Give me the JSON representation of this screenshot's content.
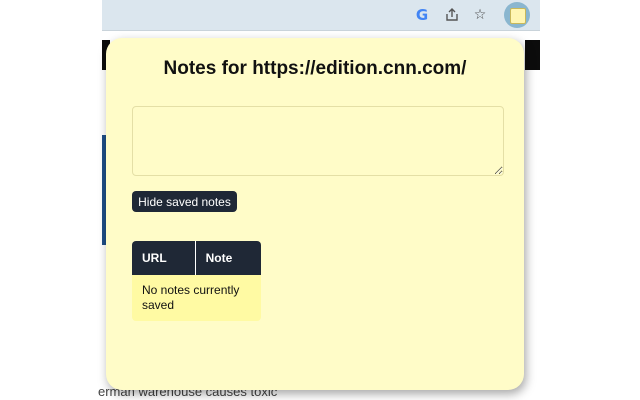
{
  "browser": {
    "icons": [
      "google-icon",
      "share-icon",
      "star-icon",
      "notes-extension-icon"
    ]
  },
  "page_background": {
    "bottom_text": "erman warehouse causes toxic"
  },
  "popup": {
    "title": "Notes for https://edition.cnn.com/",
    "note_input_value": "",
    "hide_button_label": "Hide saved notes",
    "table": {
      "columns": [
        "URL",
        "Note"
      ],
      "empty_message": "No notes currently saved"
    },
    "colors": {
      "background": "#fffcc8",
      "button": "#1f2836",
      "table_row": "#fffaa3"
    }
  }
}
